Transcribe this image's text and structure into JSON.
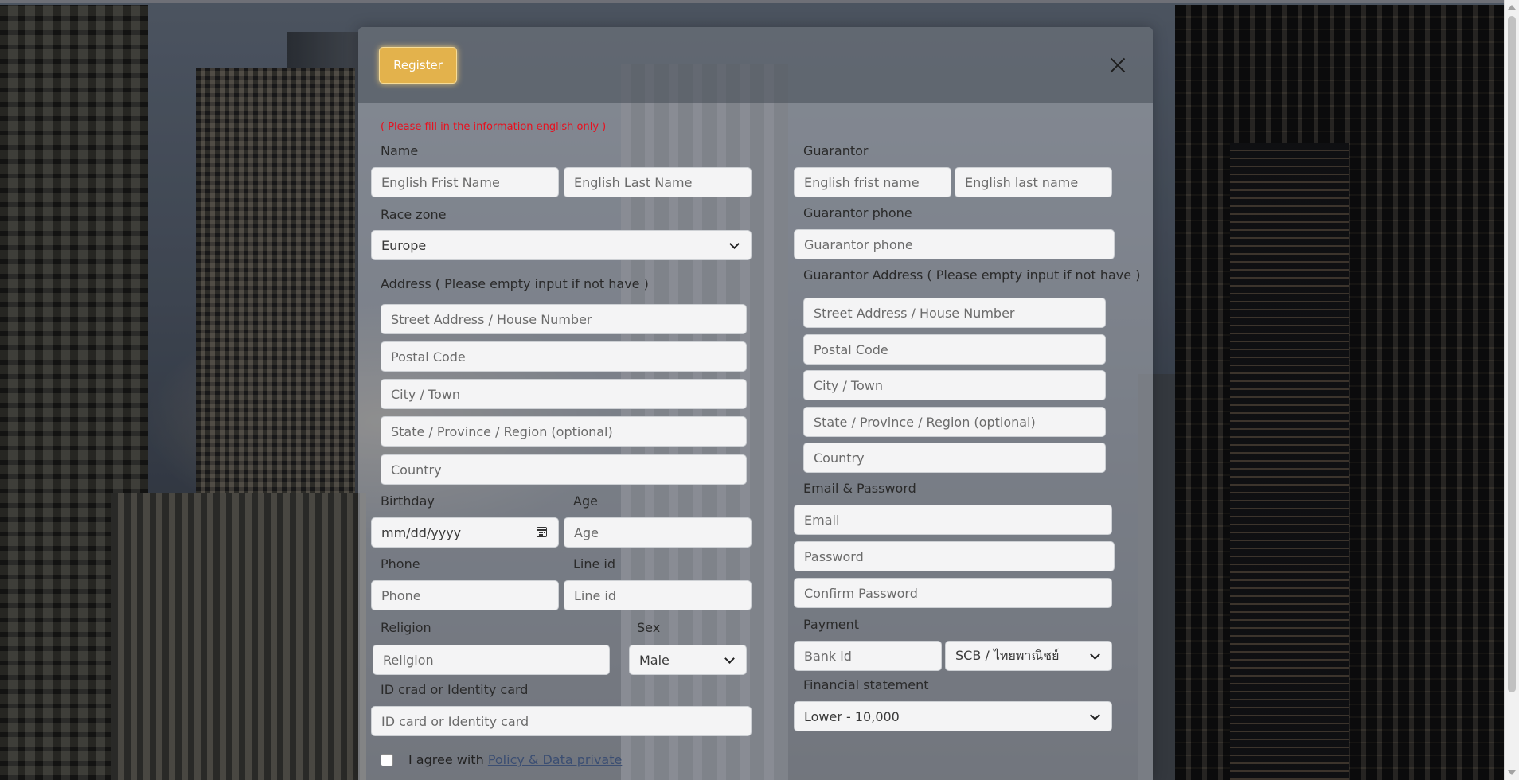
{
  "modal": {
    "register_label": "Register",
    "warning": "( Please fill in the information english only )"
  },
  "left": {
    "name_label": "Name",
    "first_name_placeholder": "English Frist Name",
    "last_name_placeholder": "English Last Name",
    "race_zone_label": "Race zone",
    "race_zone_value": "Europe",
    "address_label": "Address ( Please empty input if not have )",
    "street_placeholder": "Street Address / House Number",
    "postal_placeholder": "Postal Code",
    "city_placeholder": "City / Town",
    "state_placeholder": "State / Province / Region (optional)",
    "country_placeholder": "Country",
    "birthday_label": "Birthday",
    "birthday_placeholder": "mm/dd/yyyy",
    "age_label": "Age",
    "age_placeholder": "Age",
    "phone_label": "Phone",
    "phone_placeholder": "Phone",
    "line_label": "Line id",
    "line_placeholder": "Line id",
    "religion_label": "Religion",
    "religion_placeholder": "Religion",
    "sex_label": "Sex",
    "sex_value": "Male",
    "id_label": "ID crad or Identity card",
    "id_placeholder": "ID card or Identity card",
    "agree_text": "I agree with",
    "policy_link": "Policy & Data private"
  },
  "right": {
    "guarantor_label": "Guarantor",
    "g_first_placeholder": "English frist name",
    "g_last_placeholder": "English last name",
    "g_phone_label": "Guarantor phone",
    "g_phone_placeholder": "Guarantor phone",
    "g_address_label": "Guarantor Address ( Please empty input if not have )",
    "g_street_placeholder": "Street Address / House Number",
    "g_postal_placeholder": "Postal Code",
    "g_city_placeholder": "City / Town",
    "g_state_placeholder": "State / Province / Region (optional)",
    "g_country_placeholder": "Country",
    "email_pw_label": "Email & Password",
    "email_placeholder": "Email",
    "password_placeholder": "Password",
    "confirm_placeholder": "Confirm Password",
    "payment_label": "Payment",
    "bank_id_placeholder": "Bank id",
    "bank_value": "SCB / ไทยพาณิชย์",
    "financial_label": "Financial statement",
    "financial_value": "Lower - 10,000"
  },
  "colors": {
    "register_button": "#e3b24c",
    "warning_text": "#e8101e",
    "link": "#3b4e72"
  }
}
